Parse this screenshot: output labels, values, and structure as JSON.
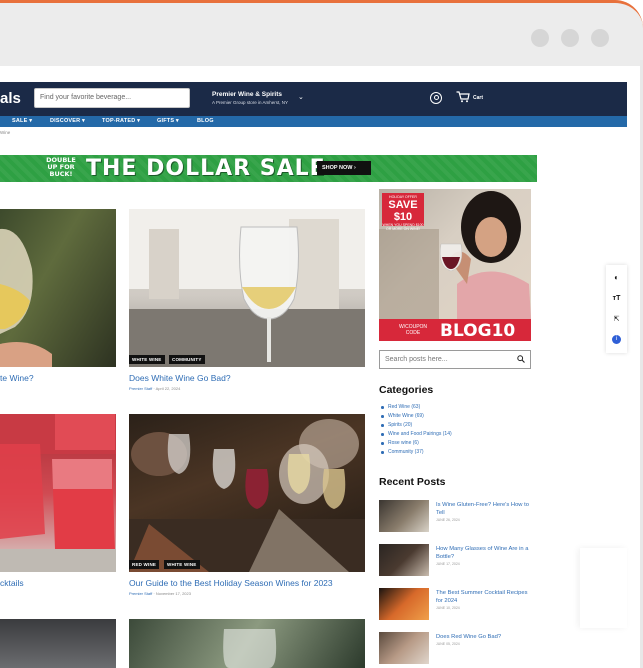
{
  "header": {
    "logo": "als",
    "search_placeholder": "Find your favorite beverage...",
    "store_name": "Premier Wine & Spirits",
    "store_sub": "A Premier Group store in Amherst, NY",
    "cart": "Cart"
  },
  "nav": [
    "SALE ▾",
    "DISCOVER ▾",
    "TOP-RATED ▾",
    "GIFTS ▾",
    "BLOG"
  ],
  "breadcrumb": "Wine",
  "banner": {
    "badge": "DOUBLE UP FOR BUCK!",
    "title": "THE DOLLAR SALE",
    "cta": "SHOP NOW ›"
  },
  "posts": [
    {
      "title": "te Wine?"
    },
    {
      "title": "Does White Wine Go Bad?",
      "tags": [
        "WHITE WINE",
        "COMMUNITY"
      ],
      "author": "Premier Staff",
      "date": "April 22, 2024"
    },
    {
      "title": "cktails"
    },
    {
      "title": "Our Guide to the Best Holiday Season Wines for 2023",
      "tags": [
        "RED WINE",
        "WHITE WINE"
      ],
      "author": "Premier Staff",
      "date": "November 17, 2023"
    }
  ],
  "promo": {
    "kicker": "HOLIDAY OFFER",
    "save": "SAVE $10",
    "condition": "WHEN YOU SPEND $100 OR MORE ON WINE!",
    "code_label": "W/COUPON CODE",
    "code": "BLOG10"
  },
  "sidebar": {
    "search_placeholder": "Search posts here...",
    "categories_heading": "Categories",
    "categories": [
      "Red Wine (63)",
      "White Wine (69)",
      "Spirits (20)",
      "Wine and Food Pairings (14)",
      "Rose wine (6)",
      "Community (37)"
    ],
    "recent_heading": "Recent Posts",
    "recent": [
      {
        "title": "Is Wine Gluten-Free? Here's How to Tell",
        "date": "JUNE 26, 2024"
      },
      {
        "title": "How Many Glasses of Wine Are in a Bottle?",
        "date": "JUNE 17, 2024"
      },
      {
        "title": "The Best Summer Cocktail Recipes for 2024",
        "date": "JUNE 10, 2024"
      },
      {
        "title": "Does Red Wine Go Bad?",
        "date": "JUNE 05, 2024"
      }
    ]
  },
  "colors": {
    "header": "#1b2a47",
    "nav": "#2469a8",
    "banner": "#2ea043",
    "link": "#2f6db5",
    "promo_red": "#d7283a",
    "frame_accent": "#e8713c"
  },
  "icons": [
    "user-icon",
    "cart-icon",
    "search-icon",
    "contrast-icon",
    "text-size-icon",
    "cursor-icon",
    "info-icon"
  ]
}
